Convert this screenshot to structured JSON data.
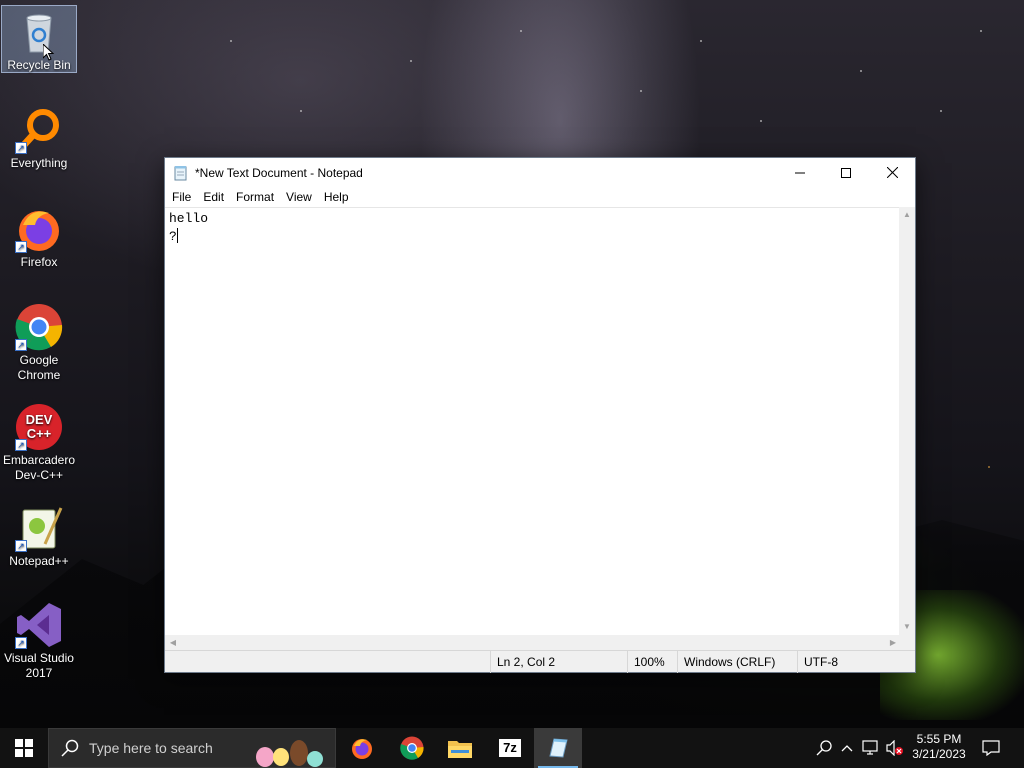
{
  "desktop": {
    "icons": [
      {
        "label": "Recycle Bin",
        "icon": "recycle-bin-icon"
      },
      {
        "label": "Everything",
        "icon": "everything-search-icon"
      },
      {
        "label": "Firefox",
        "icon": "firefox-icon"
      },
      {
        "label": "Google Chrome",
        "icon": "chrome-icon"
      },
      {
        "label": "Embarcadero Dev-C++",
        "icon": "devcpp-icon",
        "badge": "DEV C++"
      },
      {
        "label": "Notepad++",
        "icon": "notepadpp-icon"
      },
      {
        "label": "Visual Studio 2017",
        "icon": "visual-studio-icon"
      }
    ]
  },
  "window": {
    "title": "*New Text Document - Notepad",
    "controls": {
      "minimize": "—",
      "maximize": "☐",
      "close": "✕"
    },
    "menu": [
      "File",
      "Edit",
      "Format",
      "View",
      "Help"
    ],
    "editor": {
      "line1": "hello",
      "line2": "?"
    },
    "status": {
      "position": "Ln 2, Col 2",
      "zoom": "100%",
      "line_ending": "Windows (CRLF)",
      "encoding": "UTF-8"
    }
  },
  "taskbar": {
    "search_placeholder": "Type here to search",
    "time": "5:55 PM",
    "date": "3/21/2023",
    "pinned": [
      "firefox-icon",
      "chrome-icon",
      "file-explorer-icon",
      "7zip-icon",
      "notepad-icon"
    ],
    "seven_zip_label": "7z"
  },
  "colors": {
    "taskbar": "#121212",
    "accent": "#76b9ed",
    "title_text": "#000000"
  }
}
